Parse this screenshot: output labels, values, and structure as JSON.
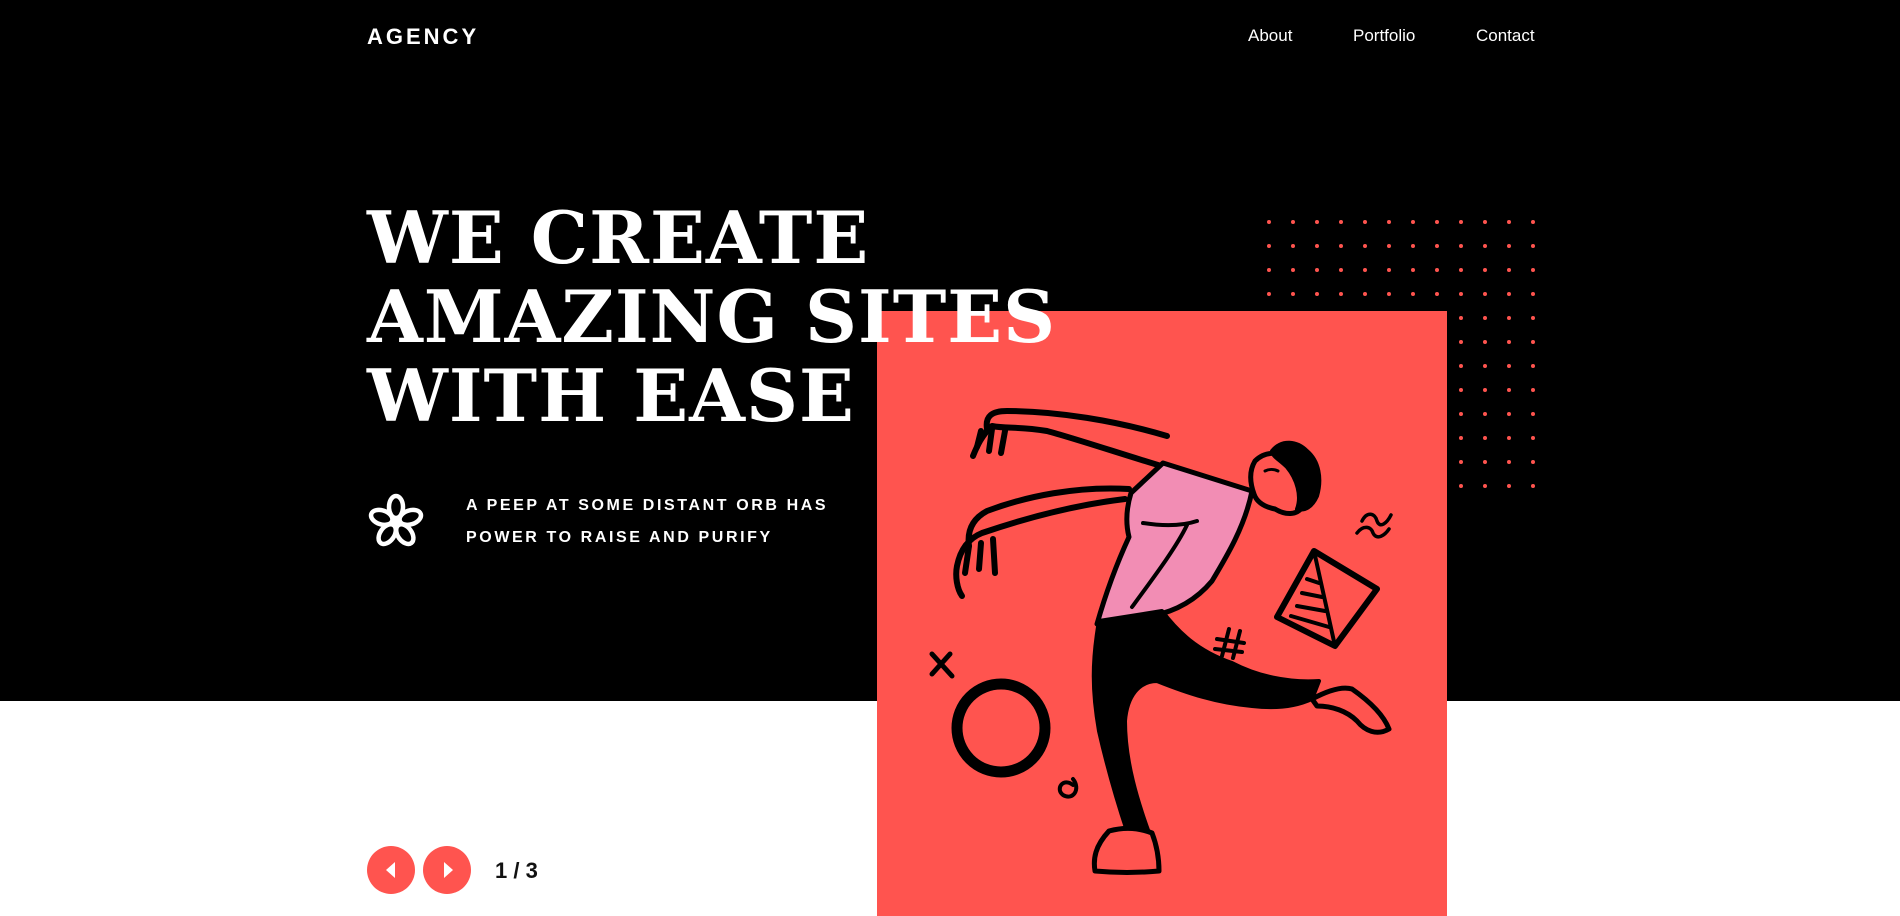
{
  "brand": {
    "logo": "AGENCY"
  },
  "nav": {
    "items": [
      {
        "label": "About"
      },
      {
        "label": "Portfolio"
      },
      {
        "label": "Contact"
      }
    ]
  },
  "hero": {
    "headline_lines": [
      "WE CREATE",
      "AMAZING SITES",
      "WITH EASE"
    ],
    "tagline_lines": [
      "A PEEP AT SOME DISTANT ORB HAS",
      "POWER TO RAISE AND PURIFY"
    ],
    "tagline_icon": "flower-icon",
    "illustration": "dancing-man-illustration"
  },
  "slider": {
    "prev_icon": "arrow-left-icon",
    "next_icon": "arrow-right-icon",
    "counter": "1 / 3"
  },
  "colors": {
    "accent": "#ff544f",
    "hero_background": "#000000",
    "page_background": "#ffffff",
    "shirt": "#f28db4",
    "text_light": "#ffffff"
  }
}
